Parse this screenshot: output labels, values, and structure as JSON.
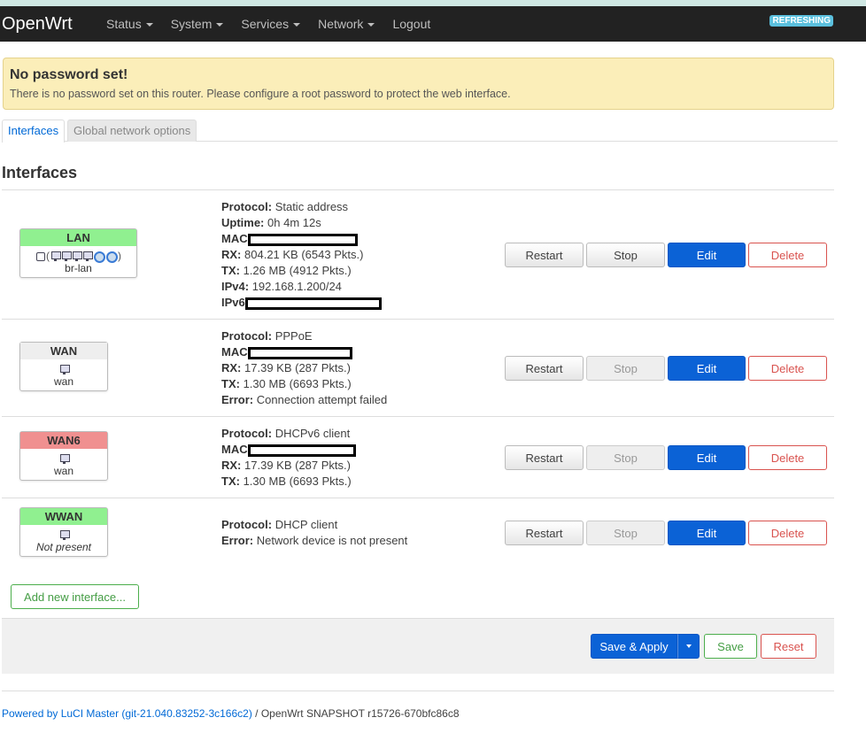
{
  "nav": {
    "brand": "OpenWrt",
    "items": [
      {
        "label": "Status",
        "has_caret": true
      },
      {
        "label": "System",
        "has_caret": true
      },
      {
        "label": "Services",
        "has_caret": true
      },
      {
        "label": "Network",
        "has_caret": true
      },
      {
        "label": "Logout",
        "has_caret": false
      }
    ],
    "refresh_badge": "REFRESHING"
  },
  "alert": {
    "title": "No password set!",
    "text": "There is no password set on this router. Please configure a root password to protect the web interface."
  },
  "tabs": [
    {
      "label": "Interfaces",
      "active": true
    },
    {
      "label": "Global network options",
      "active": false
    }
  ],
  "section_title": "Interfaces",
  "interfaces": [
    {
      "name": "LAN",
      "device": "br-lan",
      "status_color": "#90f090",
      "icons": [
        "bridge-icon",
        "ethernet-icon",
        "ethernet-icon",
        "ethernet-icon",
        "ethernet-icon",
        "wifi-icon",
        "wifi-icon"
      ],
      "info": [
        {
          "label": "Protocol:",
          "value": "Static address"
        },
        {
          "label": "Uptime:",
          "value": "0h 4m 12s"
        },
        {
          "label": "MAC",
          "value": ""
        },
        {
          "label": "RX:",
          "value": "804.21 KB (6543 Pkts.)"
        },
        {
          "label": "TX:",
          "value": "1.26 MB (4912 Pkts.)"
        },
        {
          "label": "IPv4:",
          "value": "192.168.1.200/24"
        },
        {
          "label": "IPv6",
          "value": ""
        }
      ],
      "stop_enabled": true
    },
    {
      "name": "WAN",
      "device": "wan",
      "status_color": "#eeeeee",
      "icons": [
        "ethernet-icon"
      ],
      "info": [
        {
          "label": "Protocol:",
          "value": "PPPoE"
        },
        {
          "label": "MAC",
          "value": ""
        },
        {
          "label": "RX:",
          "value": "17.39 KB (287 Pkts.)"
        },
        {
          "label": "TX:",
          "value": "1.30 MB (6693 Pkts.)"
        },
        {
          "label": "Error:",
          "value": "Connection attempt failed"
        }
      ],
      "stop_enabled": false
    },
    {
      "name": "WAN6",
      "device": "wan",
      "status_color": "#f09090",
      "icons": [
        "ethernet-icon"
      ],
      "info": [
        {
          "label": "Protocol:",
          "value": "DHCPv6 client"
        },
        {
          "label": "MAC",
          "value": ""
        },
        {
          "label": "RX:",
          "value": "17.39 KB (287 Pkts.)"
        },
        {
          "label": "TX:",
          "value": "1.30 MB (6693 Pkts.)"
        }
      ],
      "stop_enabled": false
    },
    {
      "name": "WWAN",
      "device": "Not present",
      "status_color": "#90f090",
      "icons": [
        "ethernet-icon"
      ],
      "info": [
        {
          "label": "Protocol:",
          "value": "DHCP client"
        },
        {
          "label": "Error:",
          "value": "Network device is not present"
        }
      ],
      "stop_enabled": false
    }
  ],
  "row_buttons": {
    "restart": "Restart",
    "stop": "Stop",
    "edit": "Edit",
    "delete": "Delete"
  },
  "add_interface_label": "Add new interface...",
  "actions": {
    "save_apply": "Save & Apply",
    "save": "Save",
    "reset": "Reset"
  },
  "footer": {
    "link_text": "Powered by LuCI Master (git-21.040.83252-3c166c2)",
    "separator": " / ",
    "version": "OpenWrt SNAPSHOT r15726-670bfc86c8"
  }
}
